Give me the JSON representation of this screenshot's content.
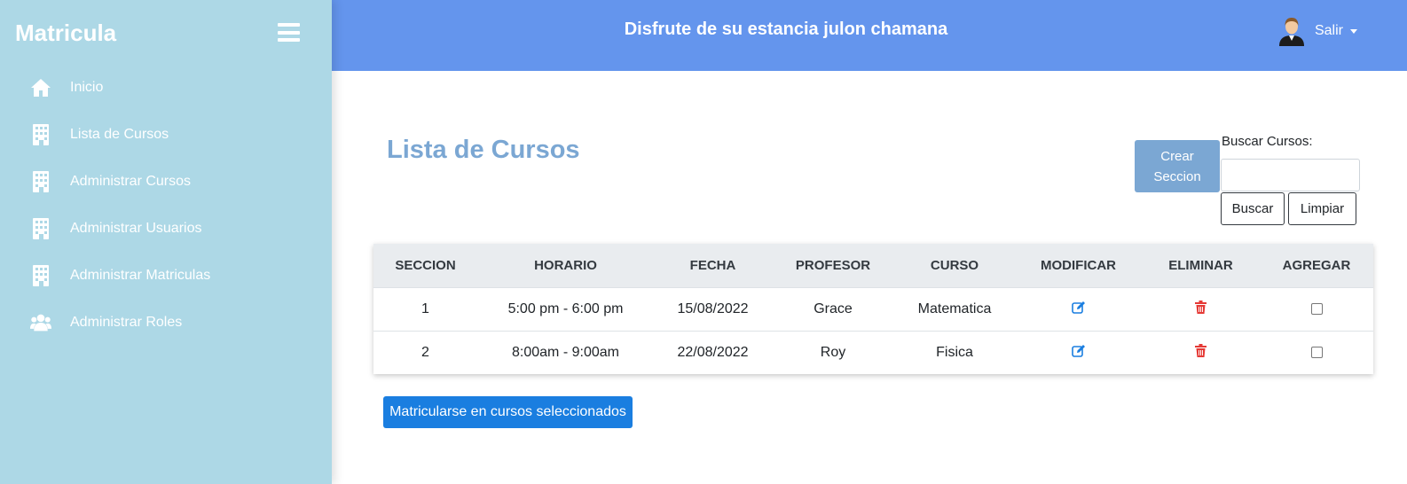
{
  "sidebar": {
    "brand": "Matricula",
    "items": [
      {
        "label": "Inicio",
        "icon": "home-icon"
      },
      {
        "label": "Lista de Cursos",
        "icon": "building-icon"
      },
      {
        "label": "Administrar Cursos",
        "icon": "building-icon"
      },
      {
        "label": "Administrar Usuarios",
        "icon": "building-icon"
      },
      {
        "label": "Administrar Matriculas",
        "icon": "building-icon"
      },
      {
        "label": "Administrar Roles",
        "icon": "users-icon"
      }
    ]
  },
  "header": {
    "title": "Disfrute de su estancia julon chamana",
    "user_menu_label": "Salir"
  },
  "main": {
    "title": "Lista de Cursos",
    "create_button_line1": "Crear",
    "create_button_line2": "Seccion",
    "search_label": "Buscar Cursos:",
    "search_value": "",
    "search_button": "Buscar",
    "clear_button": "Limpiar",
    "enroll_button": "Matricularse en cursos seleccionados"
  },
  "table": {
    "headers": [
      "SECCION",
      "HORARIO",
      "FECHA",
      "PROFESOR",
      "CURSO",
      "MODIFICAR",
      "ELIMINAR",
      "AGREGAR"
    ],
    "rows": [
      {
        "seccion": "1",
        "horario": "5:00 pm - 6:00 pm",
        "fecha": "15/08/2022",
        "profesor": "Grace",
        "curso": "Matematica",
        "checked": false
      },
      {
        "seccion": "2",
        "horario": "8:00am - 9:00am",
        "fecha": "22/08/2022",
        "profesor": "Roy",
        "curso": "Fisica",
        "checked": false
      }
    ]
  },
  "colors": {
    "sidebar_bg": "#add8e6",
    "header_bg": "#6495ed",
    "title_color": "#7ba7d3",
    "primary_button": "#1a7ee0",
    "edit_icon": "#1a7ee0",
    "delete_icon": "#e53935"
  }
}
